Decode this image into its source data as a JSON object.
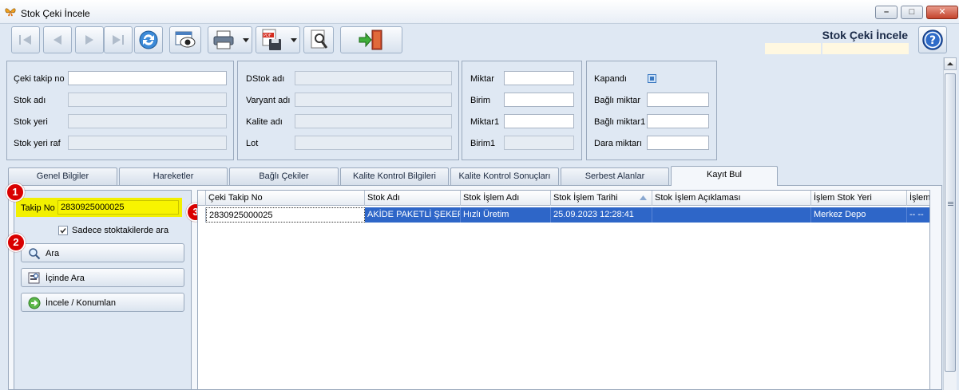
{
  "window": {
    "title": "Stok Çeki İncele",
    "page_title": "Stok Çeki İncele",
    "minimize": "–",
    "maximize": "□",
    "close": "✕"
  },
  "toolbar": {
    "icons": [
      "first-icon",
      "prev-icon",
      "next-icon",
      "last-icon",
      "refresh-icon",
      "view-icon",
      "printer-icon",
      "pdf-save-icon",
      "settings-icon",
      "exit-icon",
      "help-icon"
    ]
  },
  "header_fields": {
    "group1": {
      "ceki_takip_no_label": "Çeki takip no",
      "ceki_takip_no_value": "",
      "stok_adi_label": "Stok adı",
      "stok_yeri_label": "Stok yeri",
      "stok_yeri_raf_label": "Stok yeri raf"
    },
    "group2": {
      "dstok_adi_label": "DStok adı",
      "varyant_adi_label": "Varyant adı",
      "kalite_adi_label": "Kalite adı",
      "lot_label": "Lot"
    },
    "group3": {
      "miktar_label": "Miktar",
      "birim_label": "Birim",
      "miktar1_label": "Miktar1",
      "birim1_label": "Birim1"
    },
    "group4": {
      "kapandi_label": "Kapandı",
      "bagli_miktar_label": "Bağlı miktar",
      "bagli_miktar1_label": "Bağlı miktar1",
      "dara_miktari_label": "Dara miktarı"
    }
  },
  "tabs": [
    {
      "label": "Genel Bilgiler"
    },
    {
      "label": "Hareketler"
    },
    {
      "label": "Bağlı Çekiler"
    },
    {
      "label": "Kalite Kontrol Bilgileri"
    },
    {
      "label": "Kalite Kontrol Sonuçları"
    },
    {
      "label": "Serbest Alanlar"
    },
    {
      "label": "Kayıt Bul"
    }
  ],
  "active_tab": "Kayıt Bul",
  "search_panel": {
    "takip_no_label": "Takip No",
    "takip_no_value": "2830925000025",
    "only_in_stock_label": "Sadece stoktakilerde ara",
    "only_in_stock_checked": true,
    "ara_label": "Ara",
    "icinde_ara_label": "İçinde Ara",
    "incele_label": "İncele / Konumlan"
  },
  "badges": [
    "1",
    "2",
    "3"
  ],
  "grid": {
    "columns": [
      "Çeki Takip No",
      "Stok Adı",
      "Stok İşlem Adı",
      "Stok İşlem Tarihi",
      "Stok İşlem Açıklaması",
      "İşlem Stok Yeri",
      "İşlem"
    ],
    "rows": [
      [
        "2830925000025",
        "AKİDE PAKETLİ ŞEKER",
        "Hızlı Üretim",
        "25.09.2023 12:28:41",
        "",
        "Merkez Depo",
        "-- --"
      ]
    ]
  }
}
